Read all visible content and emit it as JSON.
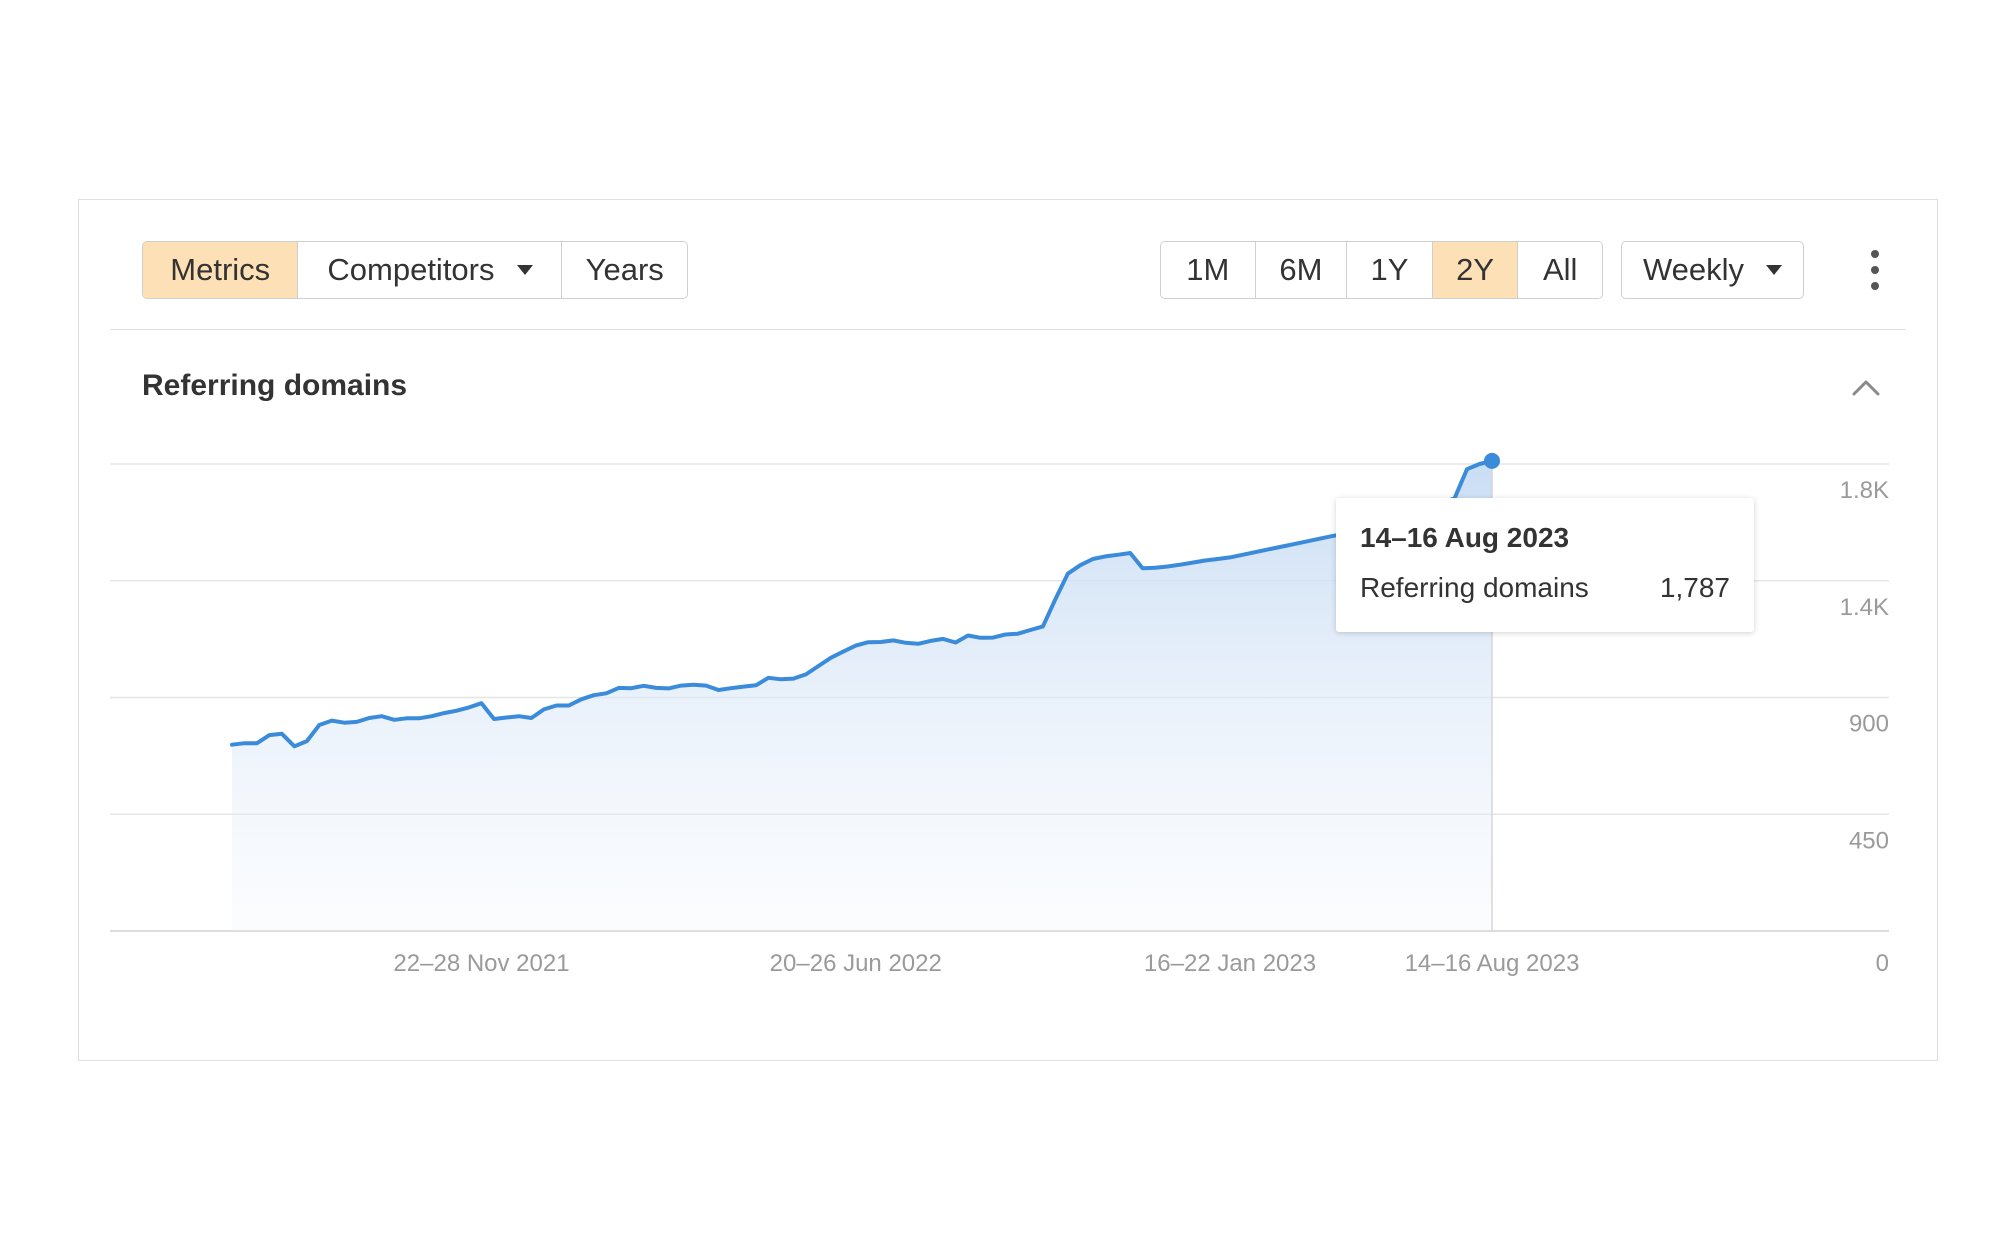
{
  "toolbar": {
    "view_tabs": [
      {
        "label": "Metrics",
        "active": true
      },
      {
        "label": "Competitors",
        "active": false,
        "has_dropdown": true
      },
      {
        "label": "Years",
        "active": false
      }
    ],
    "range_tabs": [
      {
        "label": "1M",
        "active": false
      },
      {
        "label": "6M",
        "active": false
      },
      {
        "label": "1Y",
        "active": false
      },
      {
        "label": "2Y",
        "active": true
      },
      {
        "label": "All",
        "active": false
      }
    ],
    "interval_label": "Weekly",
    "more_icon": "kebab-vertical-icon",
    "active_color": "#fde0b5"
  },
  "section": {
    "title": "Referring domains",
    "collapse_icon": "chevron-up-icon"
  },
  "tooltip": {
    "date": "14–16 Aug 2023",
    "metric_label": "Referring domains",
    "metric_value": "1,787"
  },
  "chart_data": {
    "type": "area",
    "series": [
      {
        "name": "Referring domains",
        "color": "#3b8bdb",
        "values": [
          718,
          724,
          724,
          755,
          760,
          712,
          732,
          794,
          811,
          803,
          806,
          821,
          828,
          814,
          820,
          820,
          828,
          840,
          849,
          862,
          878,
          817,
          823,
          828,
          821,
          854,
          869,
          869,
          893,
          909,
          916,
          937,
          936,
          945,
          937,
          935,
          946,
          949,
          946,
          929,
          936,
          942,
          947,
          976,
          970,
          973,
          989,
          1021,
          1053,
          1077,
          1100,
          1113,
          1114,
          1120,
          1111,
          1107,
          1118,
          1126,
          1112,
          1139,
          1130,
          1131,
          1143,
          1146,
          1160,
          1174,
          1279,
          1377,
          1410,
          1434,
          1444,
          1450,
          1457,
          1398,
          1400,
          1405,
          1412,
          1420,
          1428,
          1434,
          1440,
          1450,
          1460,
          1470,
          1480,
          1490,
          1500,
          1510,
          1520,
          1530,
          1540,
          1550,
          1560,
          1575,
          1590,
          1610,
          1630,
          1650,
          1668,
          1780,
          1800,
          1812
        ]
      }
    ],
    "x_tick_labels": [
      "22–28 Nov 2021",
      "20–26 Jun 2022",
      "16–22 Jan 2023",
      "14–16 Aug 2023"
    ],
    "y_tick_labels": [
      "0",
      "450",
      "900",
      "1.4K",
      "1.8K"
    ],
    "y_ticks": [
      0,
      450,
      900,
      1350,
      1800
    ],
    "ylim": [
      0,
      1800
    ],
    "grid": true,
    "y_axis_side": "right",
    "fill": "gradient",
    "highlighted_point": {
      "label": "14–16 Aug 2023",
      "value": 1787
    }
  }
}
